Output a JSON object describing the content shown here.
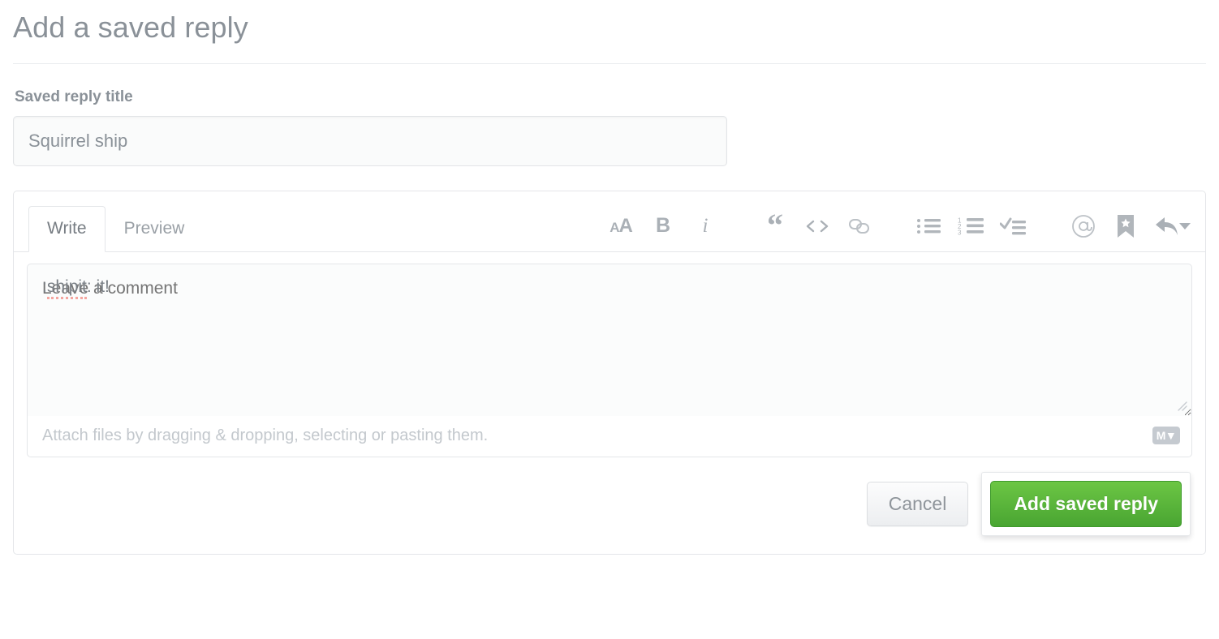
{
  "header": {
    "title": "Add a saved reply"
  },
  "title_field": {
    "label": "Saved reply title",
    "value": "Squirrel ship",
    "placeholder": "Saved reply title"
  },
  "composer": {
    "tabs": [
      {
        "label": "Write",
        "selected": true
      },
      {
        "label": "Preview",
        "selected": false
      }
    ],
    "toolbar": [
      {
        "name": "heading-icon",
        "label": "AA"
      },
      {
        "name": "bold-icon",
        "label": "B"
      },
      {
        "name": "italic-icon",
        "label": "i"
      },
      {
        "name": "quote-icon",
        "label": "“"
      },
      {
        "name": "code-icon",
        "label": "<>"
      },
      {
        "name": "link-icon",
        "label": "link"
      },
      {
        "name": "unordered-list-icon",
        "label": "bullets"
      },
      {
        "name": "ordered-list-icon",
        "label": "123"
      },
      {
        "name": "task-list-icon",
        "label": "tasks"
      },
      {
        "name": "mention-icon",
        "label": "@"
      },
      {
        "name": "saved-reply-icon",
        "label": "bookmark-star"
      },
      {
        "name": "reply-icon",
        "label": "reply"
      },
      {
        "name": "chevron-down-icon",
        "label": "caret"
      }
    ],
    "ordered_list_numbers": [
      "1",
      "2",
      "3"
    ],
    "body": {
      "value": ":shipit: it!",
      "misspelled_fragment": "shipit",
      "trailing_fragment": ": it!",
      "leading_fragment": ":",
      "placeholder": "Leave a comment"
    },
    "attach": {
      "text": "Attach files by dragging & dropping, selecting or pasting them.",
      "markdown_badge": "M"
    }
  },
  "actions": {
    "cancel_label": "Cancel",
    "submit_label": "Add saved reply"
  },
  "colors": {
    "primary_green_top": "#6cc644",
    "primary_green_bottom": "#49a532",
    "text_gray": "#8a9198",
    "border_gray": "#e4e6e9",
    "misspell_red": "#f4a6a0"
  }
}
